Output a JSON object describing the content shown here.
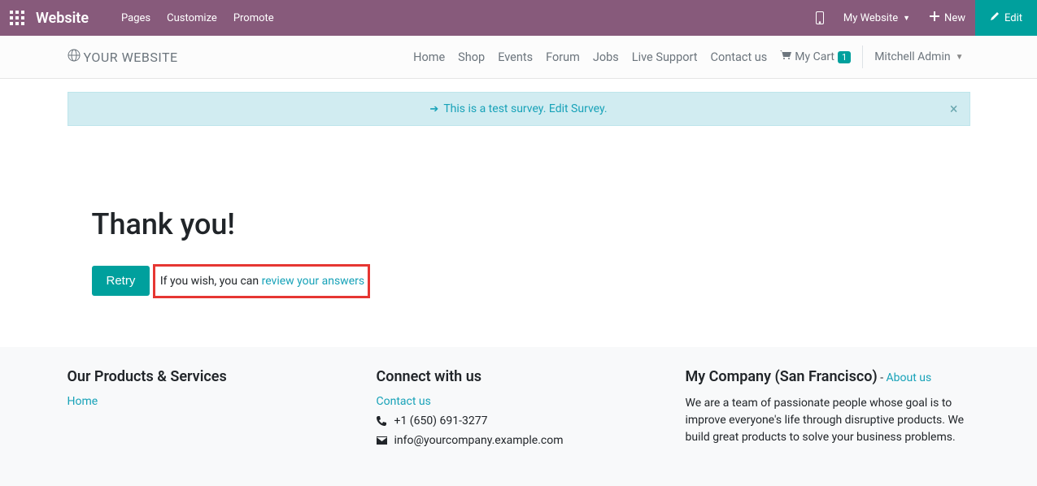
{
  "topbar": {
    "brand": "Website",
    "menu": [
      "Pages",
      "Customize",
      "Promote"
    ],
    "website_selector": "My Website",
    "new_label": "New",
    "edit_label": "Edit"
  },
  "header": {
    "logo_text": "YOUR WEBSITE",
    "nav": [
      "Home",
      "Shop",
      "Events",
      "Forum",
      "Jobs",
      "Live Support",
      "Contact us"
    ],
    "cart_label": "My Cart",
    "cart_count": "1",
    "user_name": "Mitchell Admin"
  },
  "alert": {
    "text": "This is a test survey. Edit Survey."
  },
  "main": {
    "heading": "Thank you!",
    "retry_label": "Retry",
    "review_prefix": "If you wish, you can ",
    "review_link": "review your answers"
  },
  "footer": {
    "col1": {
      "heading": "Our Products & Services",
      "link": "Home"
    },
    "col2": {
      "heading": "Connect with us",
      "contact_link": "Contact us",
      "phone": "+1 (650) 691-3277",
      "email": "info@yourcompany.example.com"
    },
    "col3": {
      "heading": "My Company (San Francisco)",
      "sep": " - ",
      "about_link": "About us",
      "body": "We are a team of passionate people whose goal is to improve everyone's life through disruptive products. We build great products to solve your business problems."
    }
  }
}
